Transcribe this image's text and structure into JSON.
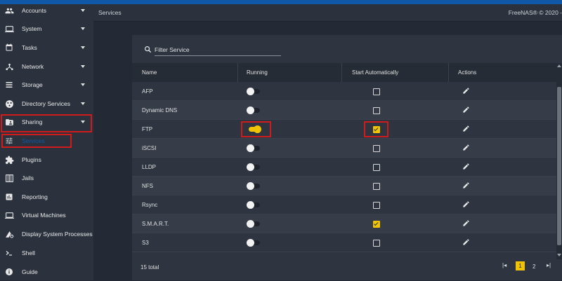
{
  "header": {
    "breadcrumb": "Services",
    "brand": "FreeNAS® © 2020 -"
  },
  "sidebar": {
    "items": [
      {
        "label": "Accounts",
        "icon": "people-icon"
      },
      {
        "label": "System",
        "icon": "laptop-icon"
      },
      {
        "label": "Tasks",
        "icon": "calendar-icon"
      },
      {
        "label": "Network",
        "icon": "network-icon"
      },
      {
        "label": "Storage",
        "icon": "storage-list-icon"
      },
      {
        "label": "Directory Services",
        "icon": "directory-icon"
      },
      {
        "label": "Sharing",
        "icon": "folder-shared-icon"
      },
      {
        "label": "Services",
        "icon": "tune-icon"
      },
      {
        "label": "Plugins",
        "icon": "puzzle-icon"
      },
      {
        "label": "Jails",
        "icon": "jail-icon"
      },
      {
        "label": "Reporting",
        "icon": "chart-icon"
      },
      {
        "label": "Virtual Machines",
        "icon": "computer-icon"
      },
      {
        "label": "Display System Processes",
        "icon": "processes-icon"
      },
      {
        "label": "Shell",
        "icon": "terminal-icon"
      },
      {
        "label": "Guide",
        "icon": "info-icon"
      }
    ],
    "active_color": "#0f58a8"
  },
  "filter": {
    "placeholder": "Filter Service",
    "icon": "search-icon"
  },
  "table": {
    "columns": {
      "name": "Name",
      "running": "Running",
      "start_automatically": "Start Automatically",
      "actions": "Actions"
    },
    "rows": [
      {
        "name": "AFP",
        "running": false,
        "start_automatically": false
      },
      {
        "name": "Dynamic DNS",
        "running": false,
        "start_automatically": false
      },
      {
        "name": "FTP",
        "running": true,
        "start_automatically": true
      },
      {
        "name": "iSCSI",
        "running": false,
        "start_automatically": false
      },
      {
        "name": "LLDP",
        "running": false,
        "start_automatically": false
      },
      {
        "name": "NFS",
        "running": false,
        "start_automatically": false
      },
      {
        "name": "Rsync",
        "running": false,
        "start_automatically": false
      },
      {
        "name": "S.M.A.R.T.",
        "running": false,
        "start_automatically": true
      },
      {
        "name": "S3",
        "running": false,
        "start_automatically": false
      }
    ]
  },
  "footer": {
    "total": "15 total",
    "pages": [
      "1",
      "2"
    ],
    "current_page": "1",
    "first_page_glyph": "|◂",
    "next_page_glyph": "▸|"
  },
  "colors": {
    "accent": "#f0c400",
    "highlight": "#d11a1a"
  }
}
